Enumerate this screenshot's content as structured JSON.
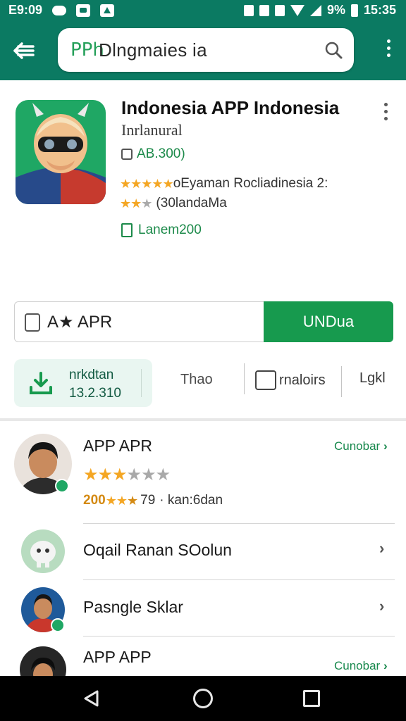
{
  "status_bar": {
    "time_left": "E9:09",
    "battery": "9%",
    "time_right": "15:35"
  },
  "search": {
    "logo": "PPh",
    "query": "Dlngmaies ia"
  },
  "app": {
    "title": "Indonesia APP Indonesia",
    "developer": "Inrlanural",
    "price": "AB.300)",
    "rating_text_1": "oEyaman Rocliadinesia 2:",
    "rating_text_2": "(30landaMa",
    "size": "Lanem200"
  },
  "install": {
    "field_text": "A★ APR",
    "button_label": "UNDua"
  },
  "actions": {
    "download_line1": "nrkdtan",
    "download_line2": "13.2.310",
    "tab_tao": "Thao",
    "tab_messages": "rnaloirs",
    "tab_link": "Lgkl"
  },
  "list": {
    "item1": {
      "title": "APP APR",
      "action": "Cunobar",
      "meta_num": "200",
      "meta_rating": "79",
      "meta_text": "· kan:6dan"
    },
    "item2": {
      "title": "Oqail Ranan SOolun"
    },
    "item3": {
      "title": "Pasngle Sklar"
    },
    "item4": {
      "title": "APP APP",
      "action": "Cunobar"
    }
  },
  "colors": {
    "primary": "#0b7a62",
    "install_green": "#179a4e",
    "star": "#f4a623"
  }
}
